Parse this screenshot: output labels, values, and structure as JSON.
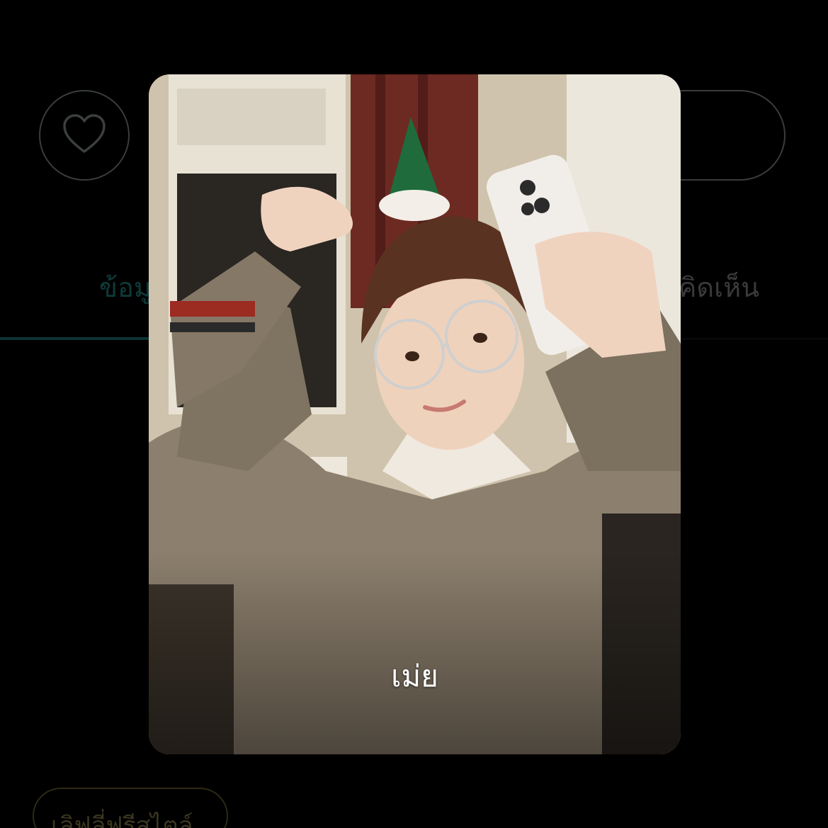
{
  "background": {
    "tabs": {
      "info_label": "ข้อมู",
      "comments_label": "คิดเห็น"
    },
    "tag_chip_label": "เลิฟลี่ฟรีสไตล์",
    "icons": {
      "like": "heart-icon"
    }
  },
  "card": {
    "caption": "เม่ย",
    "photo": "photo of a person wearing glasses and a small green party hat holding a white phone"
  },
  "colors": {
    "page_background": "#000000",
    "active_tab": "#0f3a3a",
    "caption_text": "#ffffff"
  }
}
